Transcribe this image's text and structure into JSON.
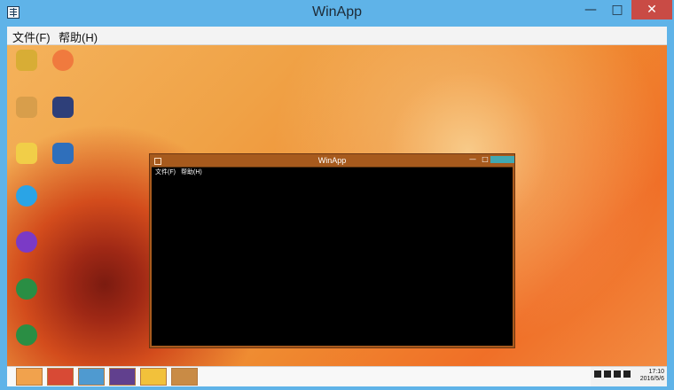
{
  "window": {
    "title": "WinApp",
    "menu": [
      "文件(F)",
      "帮助(H)"
    ]
  },
  "inner_window": {
    "title": "WinApp",
    "menu": [
      "文件(F)",
      "帮助(H)"
    ]
  },
  "tray": {
    "time": "17:10",
    "date": "2016/5/6"
  },
  "colors": {
    "titlebar": "#5fb3e8",
    "close": "#c94b45",
    "inner_close": "#41a8b1"
  }
}
